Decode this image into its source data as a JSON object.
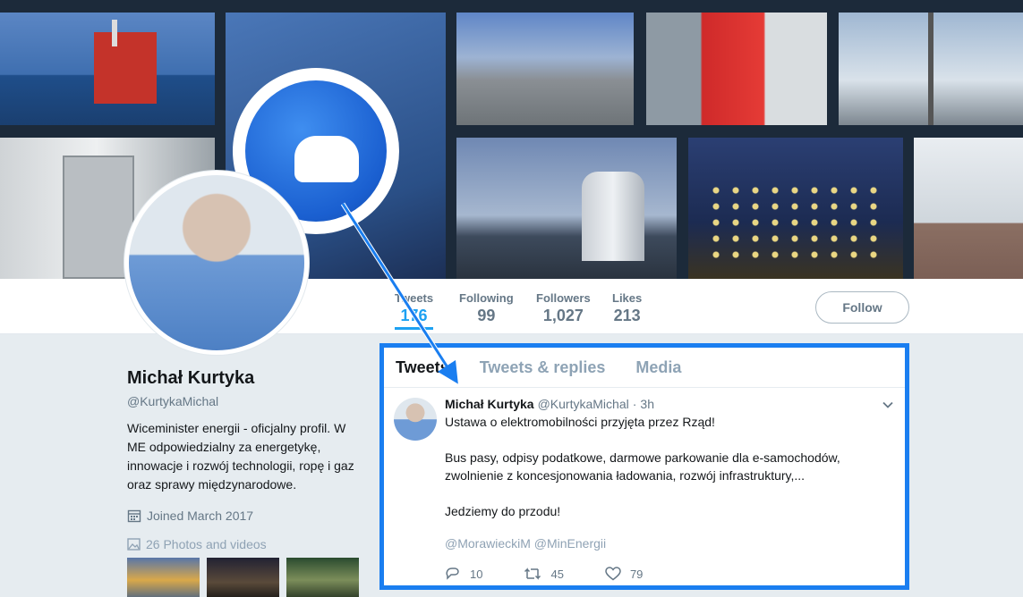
{
  "profile_nav": {
    "stats": [
      {
        "label": "Tweets",
        "value": "176"
      },
      {
        "label": "Following",
        "value": "99"
      },
      {
        "label": "Followers",
        "value": "1,027"
      },
      {
        "label": "Likes",
        "value": "213"
      }
    ],
    "follow_label": "Follow"
  },
  "profile": {
    "name": "Michał Kurtyka",
    "handle": "@KurtykaMichal",
    "bio": "Wiceminister energii - oficjalny profil. W ME odpowiedzialny za energetykę, innowacje i rozwój technologii, ropę i gaz oraz sprawy międzynarodowe.",
    "joined": "Joined March 2017",
    "photos": "26 Photos and videos"
  },
  "timeline": {
    "tabs": [
      "Tweets",
      "Tweets & replies",
      "Media"
    ],
    "tweet": {
      "name": "Michał Kurtyka",
      "handle": "@KurtykaMichal",
      "dot": "·",
      "time": "3h",
      "lines": [
        "Ustawa o elektromobilności przyjęta przez Rząd!",
        "Bus pasy, odpisy podatkowe, darmowe parkowanie dla e-samochodów, zwolnienie z koncesjonowania ładowania, rozwój infrastruktury,...",
        "Jedziemy do przodu!"
      ],
      "mentions": "@MorawieckiM @MinEnergii",
      "replies": "10",
      "retweets": "45",
      "likes": "79"
    }
  },
  "colors": {
    "accent": "#1da1f2",
    "highlight_border": "#1a7ef0"
  }
}
